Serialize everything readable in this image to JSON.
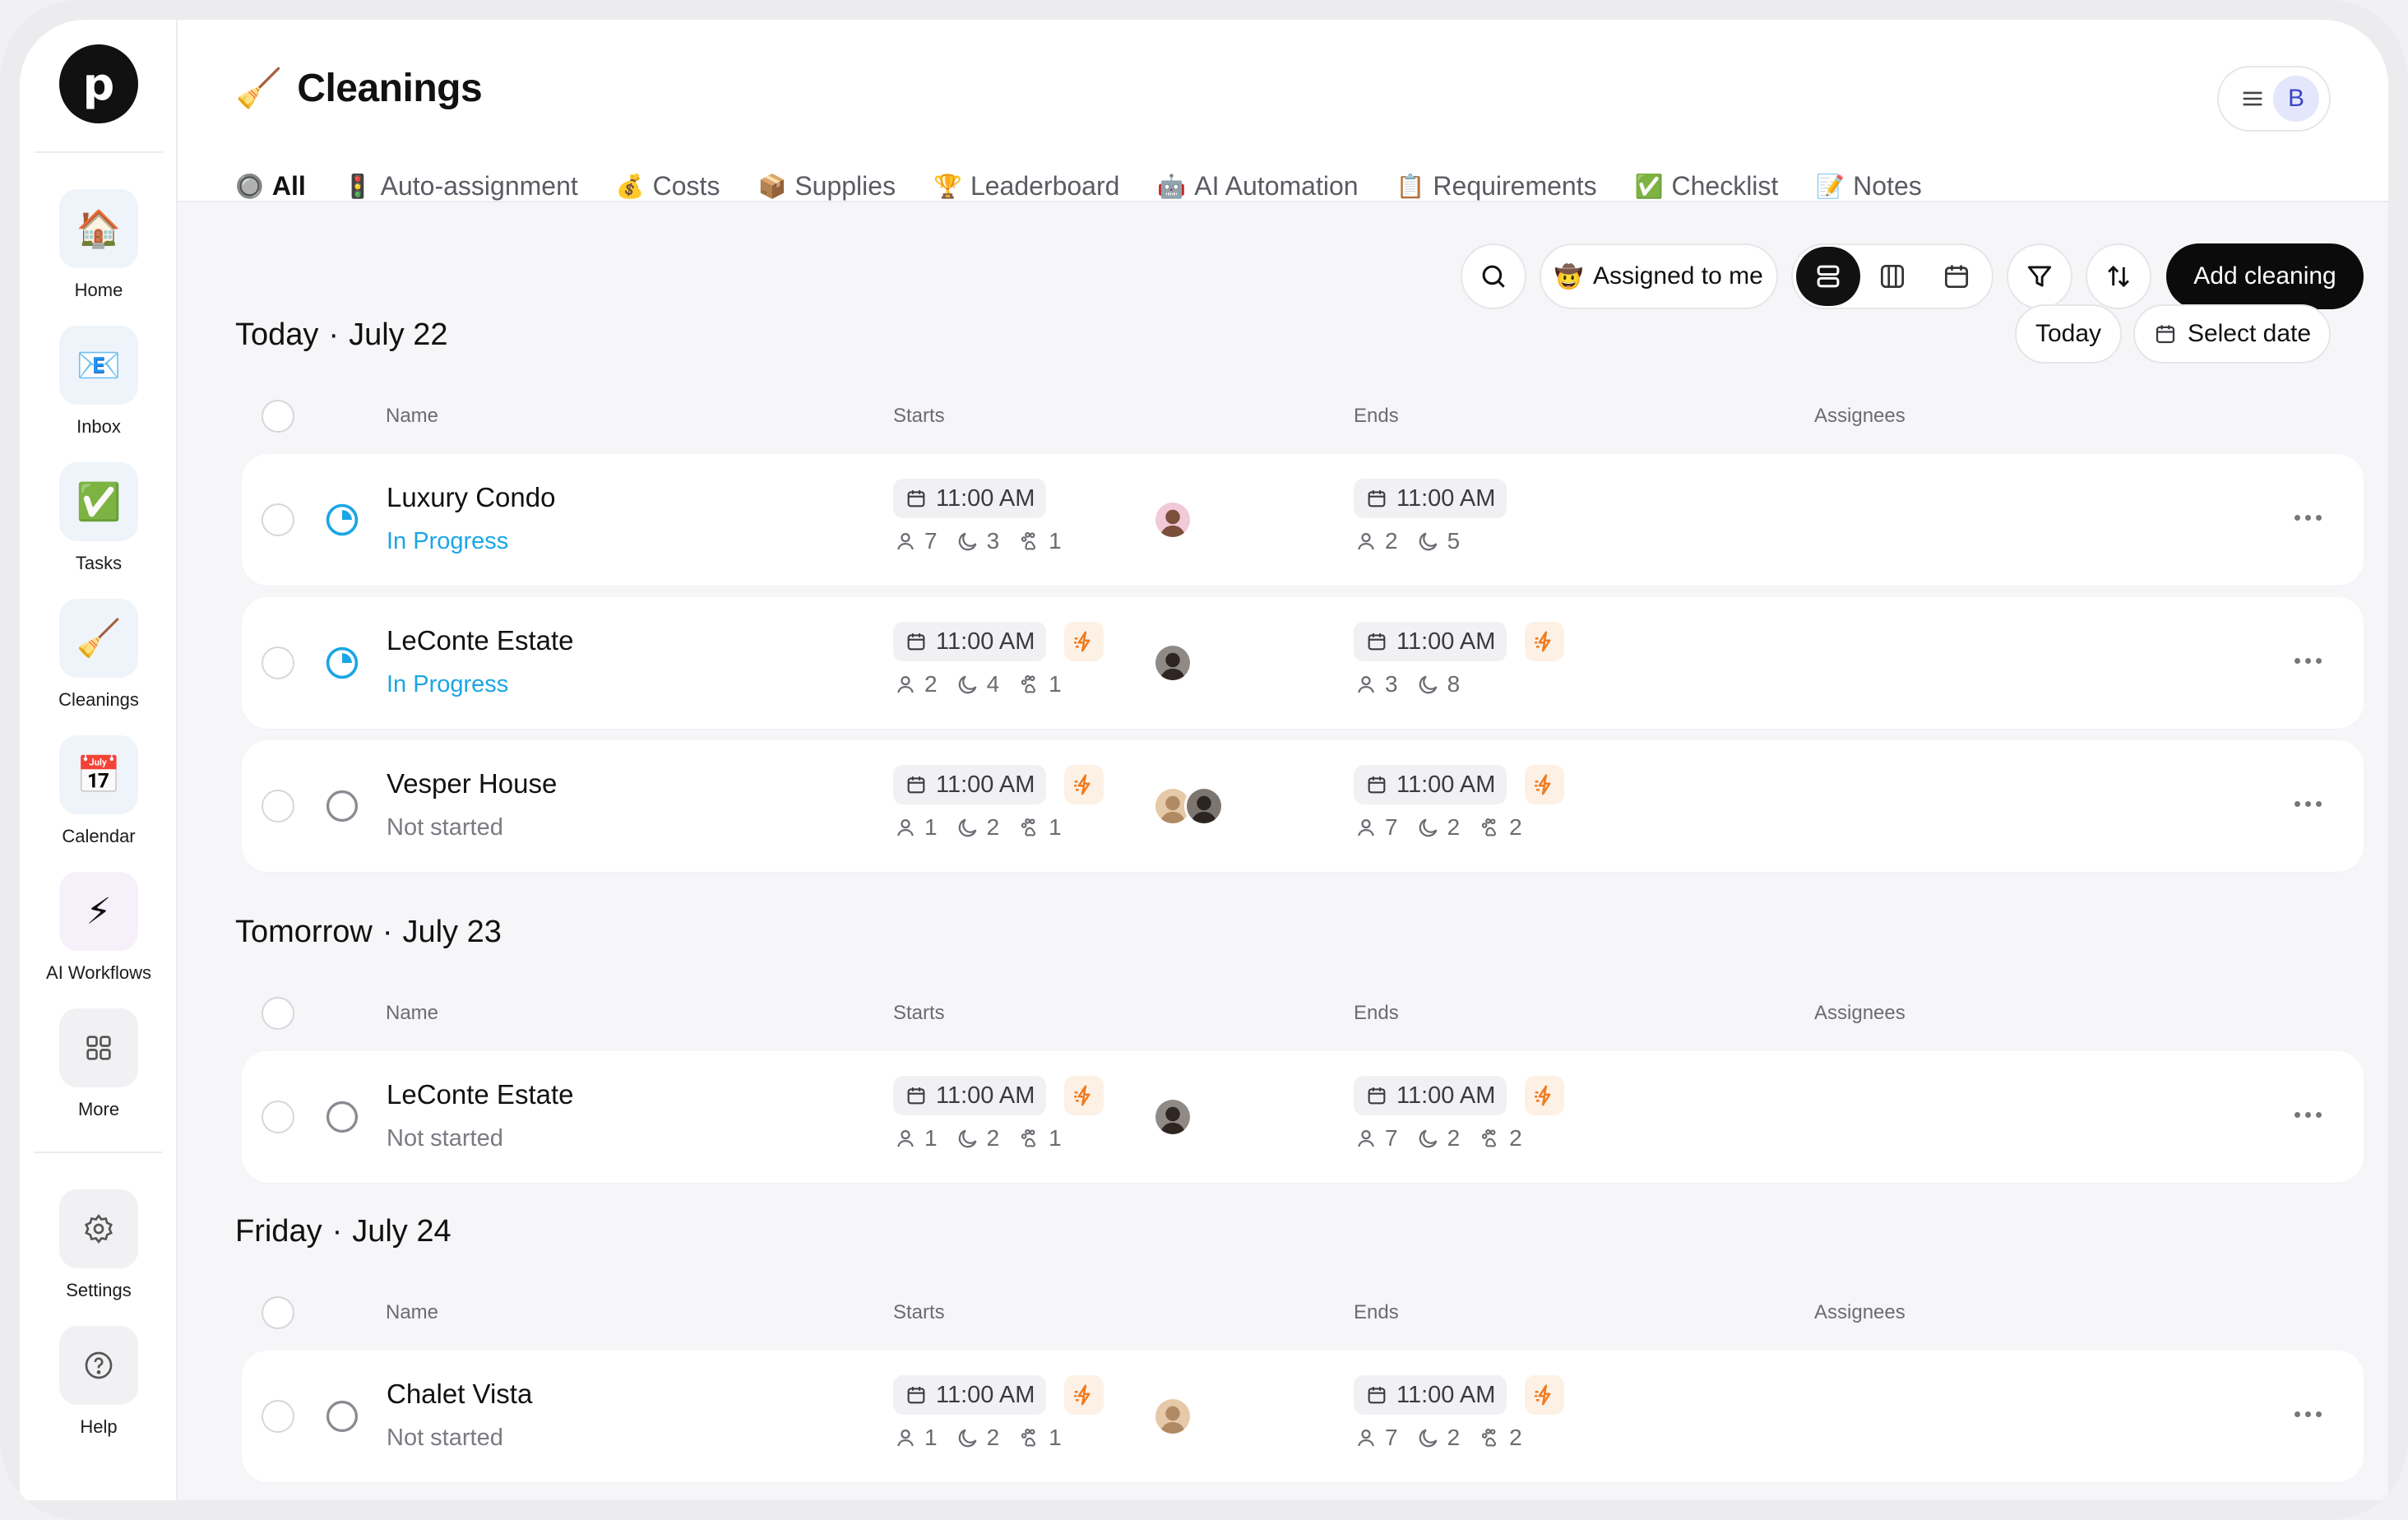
{
  "app": {
    "logo_letter": "p",
    "user_initial": "B"
  },
  "sidebar": {
    "items": [
      {
        "label": "Home",
        "icon": "🏠",
        "icon_name": "house-icon"
      },
      {
        "label": "Inbox",
        "icon": "📧",
        "icon_name": "email-icon"
      },
      {
        "label": "Tasks",
        "icon": "✅",
        "icon_name": "check-icon"
      },
      {
        "label": "Cleanings",
        "icon": "🧹",
        "icon_name": "broom-icon"
      },
      {
        "label": "Calendar",
        "icon": "📅",
        "icon_name": "calendar-icon"
      },
      {
        "label": "AI Workflows",
        "icon": "⚡",
        "icon_name": "lightning-icon"
      },
      {
        "label": "More",
        "icon_name": "grid-icon"
      }
    ],
    "bottom_items": [
      {
        "label": "Settings",
        "icon_name": "gear-icon"
      },
      {
        "label": "Help",
        "icon_name": "help-icon"
      }
    ]
  },
  "header": {
    "title": "Cleanings",
    "title_icon": "🧹",
    "tabs": [
      {
        "label": "All",
        "icon": "🔘",
        "active": true
      },
      {
        "label": "Auto-assignment",
        "icon": "🚦"
      },
      {
        "label": "Costs",
        "icon": "💰"
      },
      {
        "label": "Supplies",
        "icon": "📦"
      },
      {
        "label": "Leaderboard",
        "icon": "🏆"
      },
      {
        "label": "AI Automation",
        "icon": "🤖"
      },
      {
        "label": "Requirements",
        "icon": "📋"
      },
      {
        "label": "Checklist",
        "icon": "✅"
      },
      {
        "label": "Notes",
        "icon": "📝"
      }
    ]
  },
  "toolbar": {
    "assigned_icon": "🤠",
    "assigned_label": "Assigned to me",
    "add_label": "Add cleaning",
    "today_label": "Today",
    "select_date_label": "Select date"
  },
  "columns": {
    "name": "Name",
    "starts": "Starts",
    "ends": "Ends",
    "assignees": "Assignees"
  },
  "groups": [
    {
      "day": "Today",
      "date": "July 22",
      "rows": [
        {
          "name": "Luxury Condo",
          "status": "In Progress",
          "start": "11:00 AM",
          "end": "11:00 AM",
          "start_stats": [
            "7",
            "3",
            "1"
          ],
          "end_stats": [
            "2",
            "5"
          ],
          "start_bolt": false,
          "end_bolt": false
        },
        {
          "name": "LeConte Estate",
          "status": "In Progress",
          "start": "11:00 AM",
          "end": "11:00 AM",
          "start_stats": [
            "2",
            "4",
            "1"
          ],
          "end_stats": [
            "3",
            "8"
          ],
          "start_bolt": true,
          "end_bolt": true
        },
        {
          "name": "Vesper House",
          "status": "Not started",
          "start": "11:00 AM",
          "end": "11:00 AM",
          "start_stats": [
            "1",
            "2",
            "1"
          ],
          "end_stats": [
            "7",
            "2",
            "2"
          ],
          "start_bolt": true,
          "end_bolt": true
        }
      ]
    },
    {
      "day": "Tomorrow",
      "date": "July 23",
      "rows": [
        {
          "name": "LeConte Estate",
          "status": "Not started",
          "start": "11:00 AM",
          "end": "11:00 AM",
          "start_stats": [
            "1",
            "2",
            "1"
          ],
          "end_stats": [
            "7",
            "2",
            "2"
          ],
          "start_bolt": true,
          "end_bolt": true
        }
      ]
    },
    {
      "day": "Friday",
      "date": "July 24",
      "rows": [
        {
          "name": "Chalet Vista",
          "status": "Not started",
          "start": "11:00 AM",
          "end": "11:00 AM",
          "start_stats": [
            "1",
            "2",
            "1"
          ],
          "end_stats": [
            "7",
            "2",
            "2"
          ],
          "start_bolt": true,
          "end_bolt": true
        }
      ]
    }
  ],
  "colors": {
    "accent": "#1aa6e4",
    "primary": "#0b0b0c",
    "bolt": "#f07b1e"
  }
}
